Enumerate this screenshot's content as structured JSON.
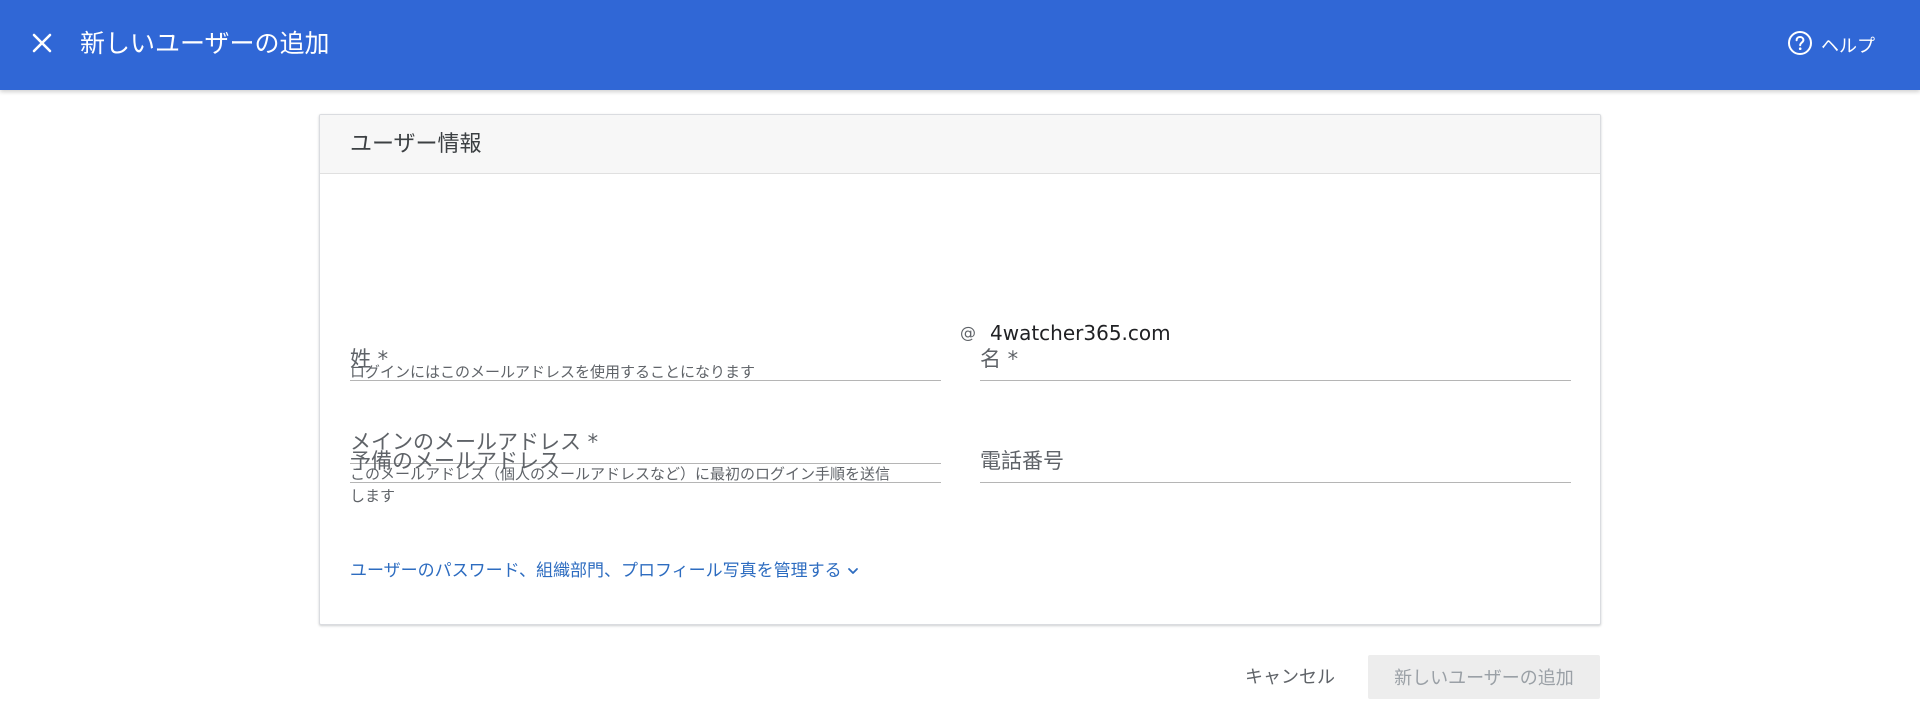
{
  "header": {
    "title": "新しいユーザーの追加",
    "help_label": "ヘルプ",
    "bg_color": "#3067d6"
  },
  "card": {
    "title": "ユーザー情報",
    "fields": {
      "last_name": "姓 *",
      "first_name": "名 *",
      "primary_email": "メインのメールアドレス *",
      "primary_email_hint": "ログインにはこのメールアドレスを使用することになります",
      "at_sign": "@",
      "domain": "4watcher365.com",
      "secondary_email": "予備のメールアドレス",
      "secondary_email_hint_line1": "このメールアドレス（個人のメールアドレスなど）に最初のログイン手順を送信",
      "secondary_email_hint_line2": "します",
      "phone": "電話番号"
    },
    "manage_link": "ユーザーのパスワード、組織部門、プロフィール写真を管理する"
  },
  "footer": {
    "cancel_label": "キャンセル",
    "add_label": "新しいユーザーの追加"
  },
  "icons": {
    "close": "close-icon",
    "help": "help-circle-icon",
    "chevron": "chevron-down-icon"
  }
}
